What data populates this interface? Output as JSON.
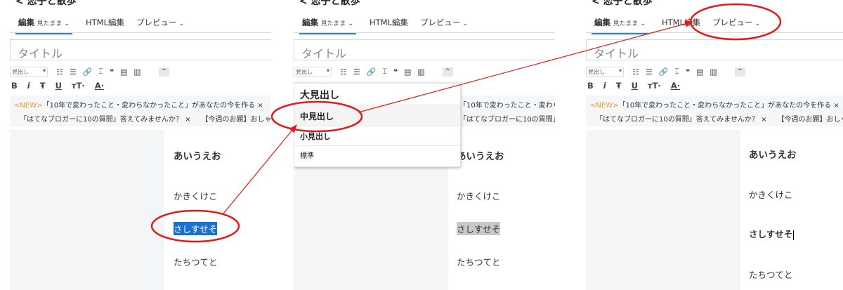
{
  "back_title": "< 恋子と散歩",
  "tabs": {
    "edit": "編集",
    "edit_sub": "見たまま",
    "html": "HTML編集",
    "preview": "プレビュー"
  },
  "title_placeholder": "タイトル",
  "toolbar": {
    "heading_select": "見出し",
    "list_ul": "☷",
    "list_ol": "☰",
    "link": "🔗",
    "hr": "⌶",
    "quote": "❝",
    "table": "▤",
    "more": "▥",
    "up": "^",
    "bold": "B",
    "italic": "i",
    "strike": "Ŧ",
    "underline": "U",
    "font_size": "ᴛT·",
    "font_color": "A·"
  },
  "topics": {
    "new_tag": "<NEW>",
    "topic1": "「10年で変わったこと・変わらなかったこと」があなたの今を作る ×",
    "topic2a": "「はてなブロガーに10の質問」答えてみませんか？ ×",
    "topic2b": "【今週のお題】おしゃべり"
  },
  "editor_lines": [
    "あいうえお",
    "かきくけこ",
    "さしすせそ",
    "たちつてと"
  ],
  "dropdown": {
    "large": "大見出し",
    "medium": "中見出し",
    "small": "小見出し",
    "normal": "標準"
  },
  "colors": {
    "accent": "#1f87d8",
    "annotation": "#e01b1b",
    "selection_blue": "#1f6fcf",
    "selection_gray": "#c8c8c8",
    "new_tag": "#e69a2e"
  }
}
